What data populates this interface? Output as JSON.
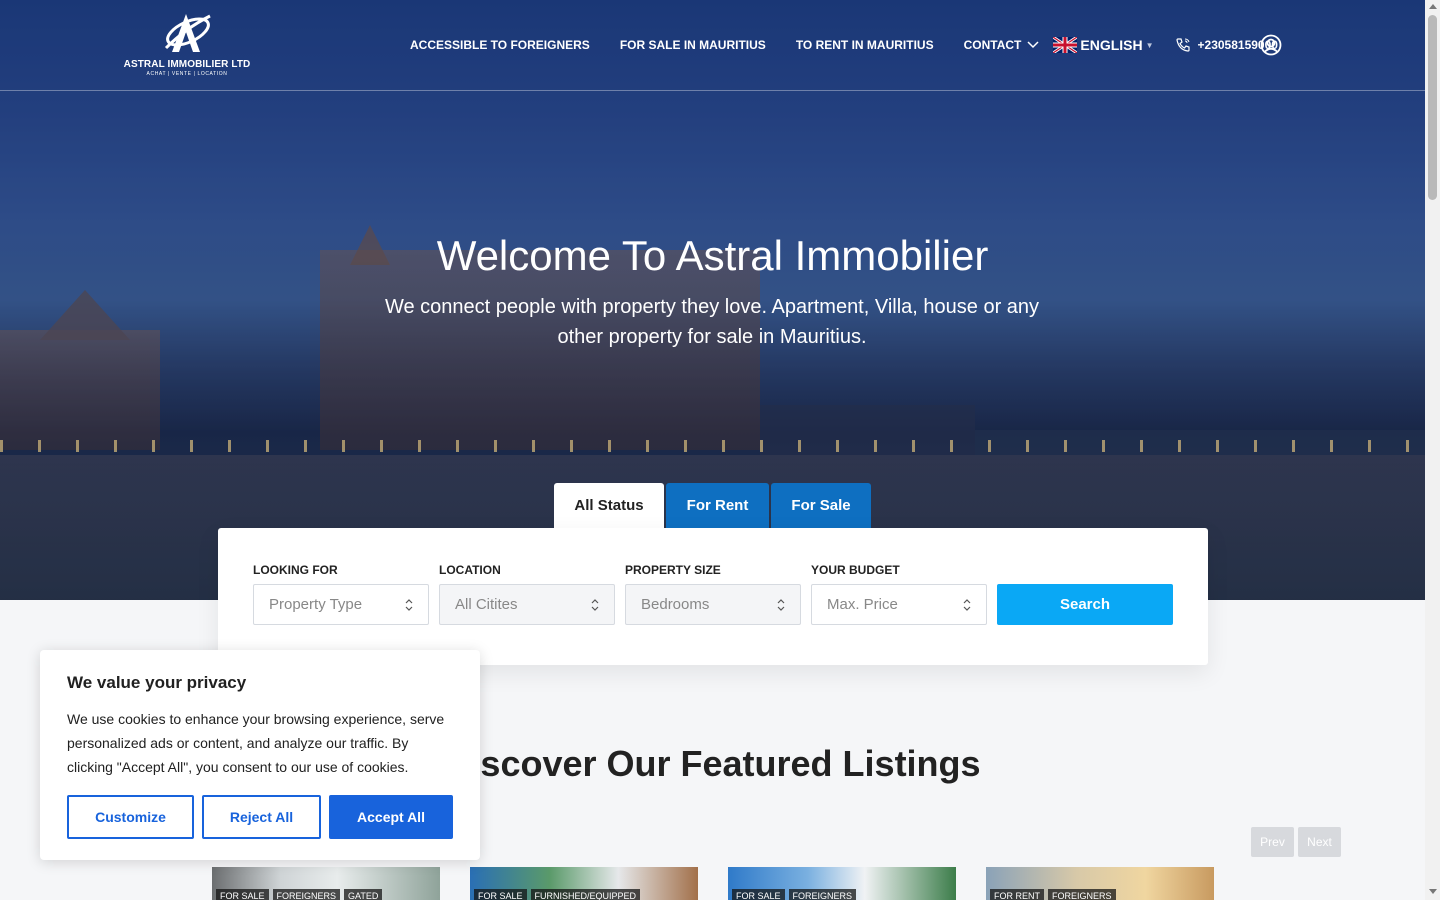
{
  "header": {
    "logo": {
      "name": "ASTRAL IMMOBILIER LTD",
      "tagline": "ACHAT | VENTE | LOCATION"
    },
    "nav": [
      {
        "label": "ACCESSIBLE TO FOREIGNERS"
      },
      {
        "label": "FOR SALE IN MAURITIUS"
      },
      {
        "label": "TO RENT IN MAURITIUS"
      }
    ],
    "contact_label": "CONTACT",
    "language": "ENGLISH",
    "phone": "+23058159000"
  },
  "hero": {
    "title": "Welcome To Astral Immobilier",
    "subtitle": "We connect people with property they love. Apartment, Villa, house or any other property for sale in Mauritius."
  },
  "tabs": [
    {
      "label": "All Status",
      "active": true
    },
    {
      "label": "For Rent",
      "active": false
    },
    {
      "label": "For Sale",
      "active": false
    }
  ],
  "search": {
    "fields": [
      {
        "label": "LOOKING FOR",
        "value": "Property Type"
      },
      {
        "label": "LOCATION",
        "value": "All Citites"
      },
      {
        "label": "PROPERTY SIZE",
        "value": "Bedrooms"
      },
      {
        "label": "YOUR BUDGET",
        "value": "Max. Price"
      }
    ],
    "button": "Search"
  },
  "featured": {
    "title": "Discover Our Featured Listings",
    "prev": "Prev",
    "next": "Next",
    "cards": [
      {
        "badges": [
          "FOR SALE",
          "FOREIGNERS",
          "GATED"
        ]
      },
      {
        "badges": [
          "FOR SALE",
          "FURNISHED/EQUIPPED"
        ]
      },
      {
        "badges": [
          "FOR SALE",
          "FOREIGNERS"
        ]
      },
      {
        "badges": [
          "FOR RENT",
          "FOREIGNERS"
        ]
      }
    ]
  },
  "cookie": {
    "title": "We value your privacy",
    "text": "We use cookies to enhance your browsing experience, serve personalized ads or content, and analyze our traffic. By clicking \"Accept All\", you consent to our use of cookies.",
    "customize": "Customize",
    "reject": "Reject All",
    "accept": "Accept All"
  },
  "colors": {
    "accent_tab": "#0e6fc1",
    "search_button": "#0aa8f5",
    "cookie_primary": "#1863dc"
  },
  "icons": [
    "logo-icon",
    "chevron-down-icon",
    "uk-flag-icon",
    "phone-icon",
    "user-icon",
    "sort-icon"
  ]
}
